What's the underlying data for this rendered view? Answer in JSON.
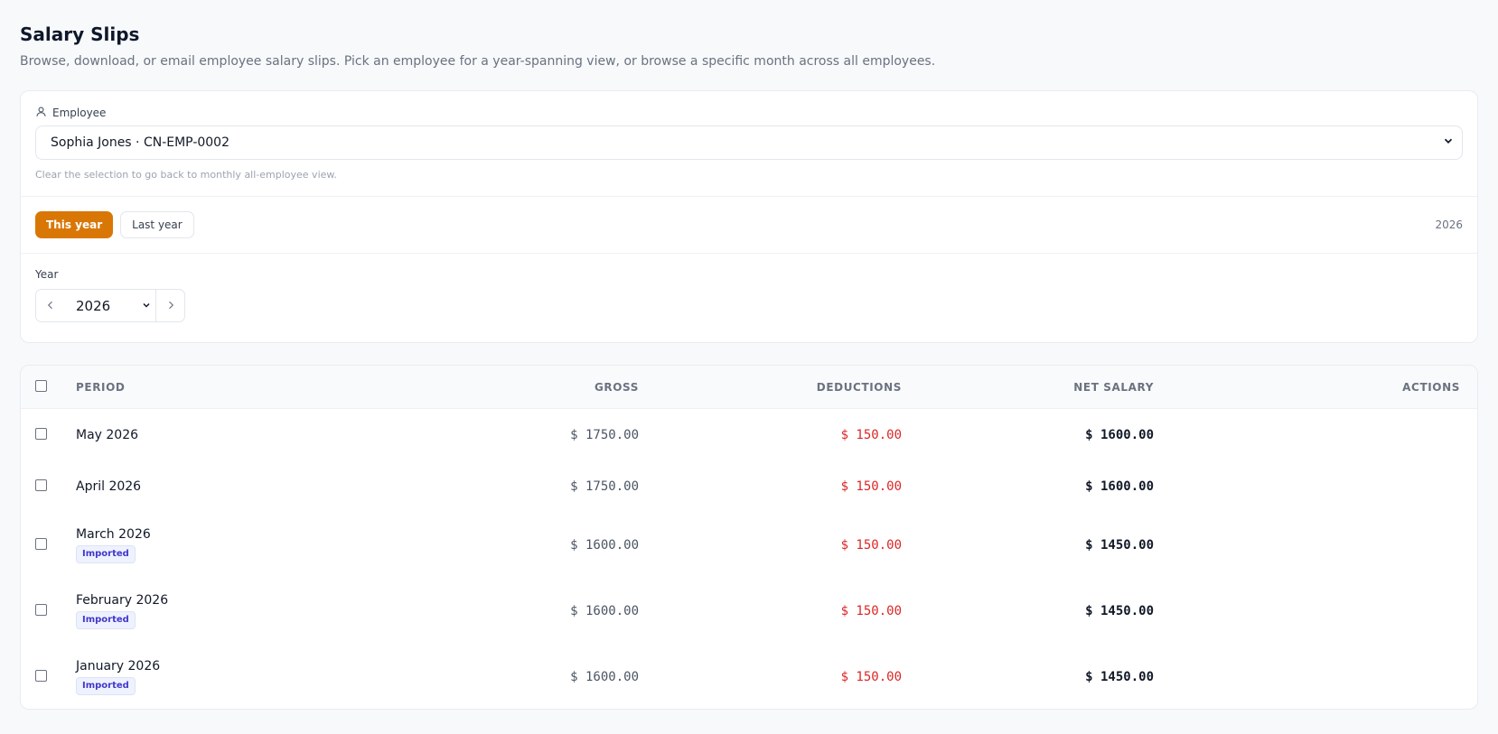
{
  "page": {
    "title": "Salary Slips",
    "subtitle": "Browse, download, or email employee salary slips. Pick an employee for a year-spanning view, or browse a specific month across all employees."
  },
  "employee_filter": {
    "label": "Employee",
    "selected": "Sophia Jones · CN-EMP-0002",
    "hint": "Clear the selection to go back to monthly all-employee view."
  },
  "range": {
    "this_year_label": "This year",
    "last_year_label": "Last year",
    "active": "This year",
    "current_year_display": "2026"
  },
  "year_picker": {
    "label": "Year",
    "selected": "2026"
  },
  "table": {
    "columns": {
      "period": "PERIOD",
      "gross": "GROSS",
      "deductions": "DEDUCTIONS",
      "net": "NET SALARY",
      "actions": "ACTIONS"
    },
    "rows": [
      {
        "period": "May 2026",
        "badge": "",
        "gross": "$ 1750.00",
        "deductions": "$ 150.00",
        "net": "$ 1600.00"
      },
      {
        "period": "April 2026",
        "badge": "",
        "gross": "$ 1750.00",
        "deductions": "$ 150.00",
        "net": "$ 1600.00"
      },
      {
        "period": "March 2026",
        "badge": "Imported",
        "gross": "$ 1600.00",
        "deductions": "$ 150.00",
        "net": "$ 1450.00"
      },
      {
        "period": "February 2026",
        "badge": "Imported",
        "gross": "$ 1600.00",
        "deductions": "$ 150.00",
        "net": "$ 1450.00"
      },
      {
        "period": "January 2026",
        "badge": "Imported",
        "gross": "$ 1600.00",
        "deductions": "$ 150.00",
        "net": "$ 1450.00"
      }
    ]
  },
  "colors": {
    "accent": "#d97706",
    "deduction_text": "#dc2626",
    "badge_text": "#4338ca",
    "badge_bg": "#eef2ff"
  }
}
